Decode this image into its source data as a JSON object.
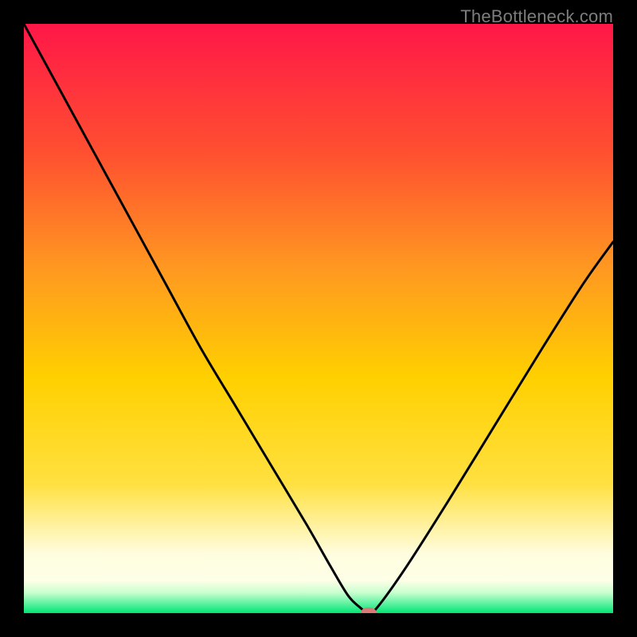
{
  "watermark": "TheBottleneck.com",
  "colors": {
    "frame": "#000000",
    "curve": "#000000",
    "marker_fill": "#d87a78",
    "marker_stroke": "#d87a78",
    "gradient_top": "#ff1748",
    "gradient_mid1": "#ff8a2a",
    "gradient_mid2": "#ffd000",
    "gradient_mid3": "#ffe040",
    "gradient_pale": "#ffffe0",
    "gradient_green": "#00e676"
  },
  "chart_data": {
    "type": "line",
    "title": "",
    "xlabel": "",
    "ylabel": "",
    "xlim": [
      0,
      100
    ],
    "ylim": [
      0,
      100
    ],
    "legend": false,
    "grid": false,
    "series": [
      {
        "name": "bottleneck-curve",
        "x": [
          0,
          6,
          12,
          18,
          24,
          30,
          36,
          42,
          48,
          52,
          55,
          57,
          58.5,
          60,
          65,
          72,
          80,
          88,
          95,
          100
        ],
        "y": [
          100,
          89,
          78,
          67,
          56,
          45,
          35,
          25,
          15,
          8,
          3,
          1,
          0,
          1,
          8,
          19,
          32,
          45,
          56,
          63
        ]
      }
    ],
    "marker": {
      "x": 58.5,
      "y": 0,
      "rx": 1.3,
      "ry": 0.9
    },
    "gradient_stops": [
      {
        "offset": 0.0,
        "color": "#ff1748"
      },
      {
        "offset": 0.22,
        "color": "#ff5030"
      },
      {
        "offset": 0.42,
        "color": "#ff9a20"
      },
      {
        "offset": 0.6,
        "color": "#ffd000"
      },
      {
        "offset": 0.78,
        "color": "#ffe040"
      },
      {
        "offset": 0.9,
        "color": "#fffde0"
      },
      {
        "offset": 0.945,
        "color": "#fdffe6"
      },
      {
        "offset": 0.965,
        "color": "#c9ffd0"
      },
      {
        "offset": 1.0,
        "color": "#00e676"
      }
    ]
  }
}
